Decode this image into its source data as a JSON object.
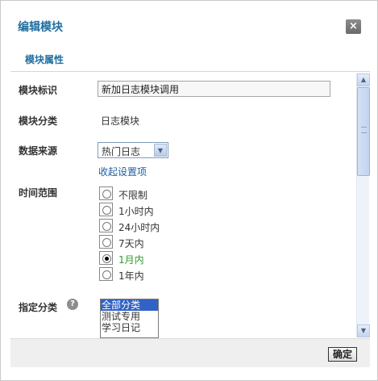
{
  "dialog": {
    "title": "编辑模块",
    "close_glyph": "×",
    "section_title": "模块属性"
  },
  "form": {
    "module_id": {
      "label": "模块标识",
      "value": "新加日志模块调用"
    },
    "module_category": {
      "label": "模块分类",
      "value": "日志模块"
    },
    "data_source": {
      "label": "数据来源",
      "selected": "热门日志",
      "collapse_link": "收起设置项"
    },
    "time_range": {
      "label": "时间范围",
      "options": [
        {
          "label": "不限制",
          "checked": false
        },
        {
          "label": "1小时内",
          "checked": false
        },
        {
          "label": "24小时内",
          "checked": false
        },
        {
          "label": "7天内",
          "checked": false
        },
        {
          "label": "1月内",
          "checked": true
        },
        {
          "label": "1年内",
          "checked": false
        }
      ]
    },
    "category_filter": {
      "label": "指定分类",
      "help_glyph": "?",
      "options": [
        {
          "label": "全部分类",
          "selected": true
        },
        {
          "label": "测试专用",
          "selected": false
        },
        {
          "label": "学习日记",
          "selected": false
        },
        {
          "label": "…",
          "selected": false
        }
      ]
    }
  },
  "footer": {
    "confirm_label": "确定"
  },
  "icons": {
    "close": "close-icon",
    "help": "help-icon",
    "dropdown": "chevron-down-icon",
    "scroll_up": "scroll-up-icon",
    "scroll_down": "scroll-down-icon"
  },
  "colors": {
    "title": "#1f6fa1",
    "link": "#1f5fa0",
    "active_option": "#2e9a2e",
    "list_selection": "#3162c6"
  }
}
